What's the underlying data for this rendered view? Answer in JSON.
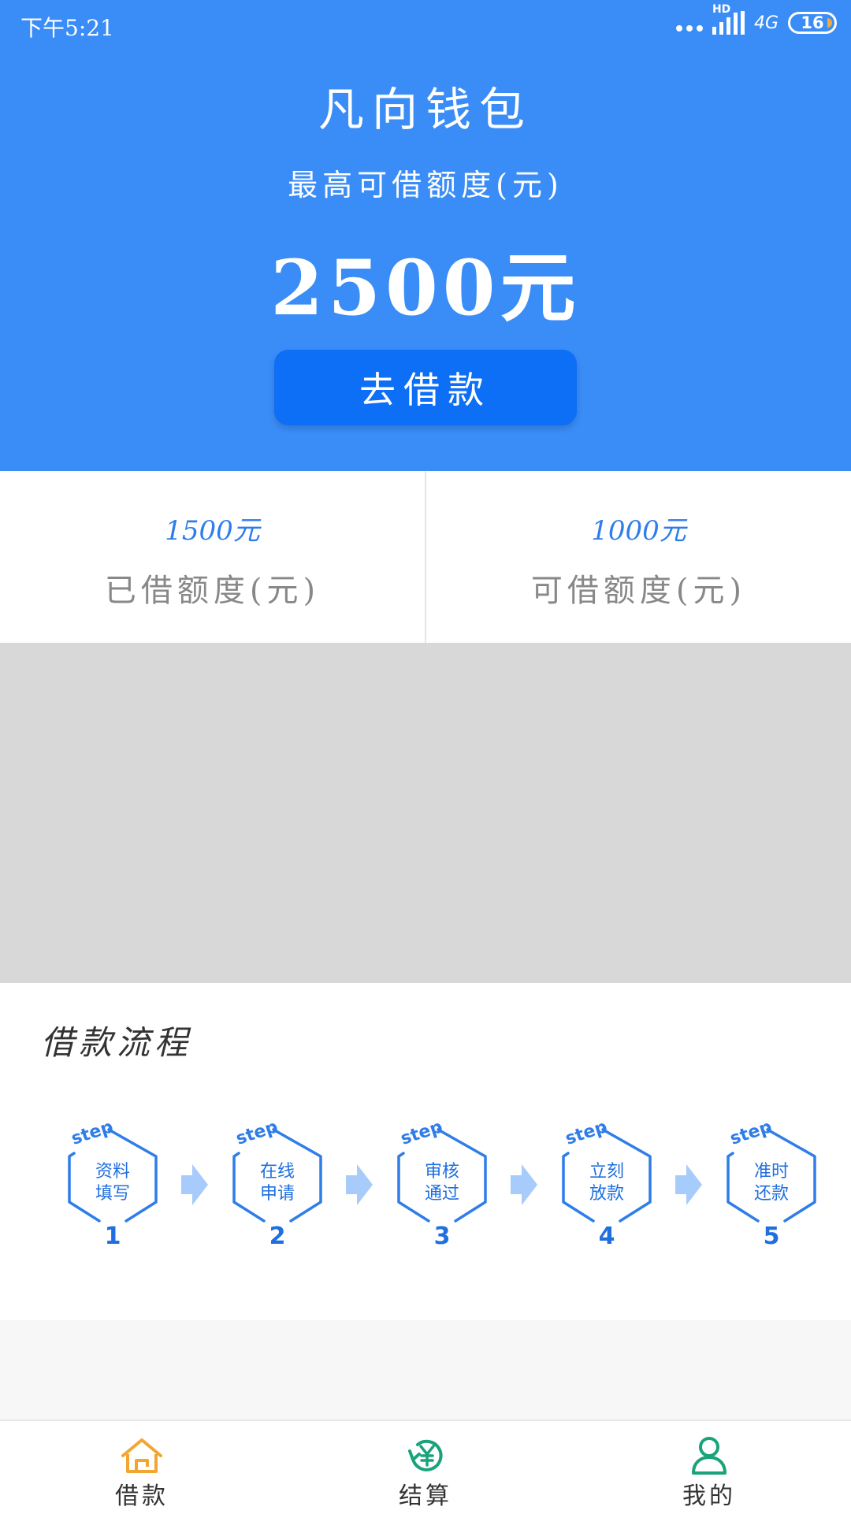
{
  "status_bar": {
    "time": "下午5:21",
    "hd": "HD",
    "network": "4G",
    "battery": "16"
  },
  "header": {
    "app_title": "凡向钱包",
    "limit_label": "最高可借额度(元)",
    "limit_amount": "2500元",
    "borrow_button": "去借款"
  },
  "amounts": {
    "borrowed_value": "1500元",
    "borrowed_label": "已借额度(元)",
    "available_value": "1000元",
    "available_label": "可借额度(元)"
  },
  "process": {
    "title": "借款流程",
    "step_word": "step",
    "steps": [
      {
        "line1": "资料",
        "line2": "填写",
        "num": "1"
      },
      {
        "line1": "在线",
        "line2": "申请",
        "num": "2"
      },
      {
        "line1": "审核",
        "line2": "通过",
        "num": "3"
      },
      {
        "line1": "立刻",
        "line2": "放款",
        "num": "4"
      },
      {
        "line1": "准时",
        "line2": "还款",
        "num": "5"
      }
    ]
  },
  "nav": {
    "items": [
      {
        "label": "借款",
        "icon": "home-icon",
        "active": true
      },
      {
        "label": "结算",
        "icon": "yen-refresh-icon"
      },
      {
        "label": "我的",
        "icon": "person-icon"
      }
    ]
  },
  "colors": {
    "header_bg": "#3a8cf6",
    "button_bg": "#0d6ef6",
    "accent": "#2f7de8",
    "nav_home": "#f3a532",
    "nav_green": "#1aa37a"
  }
}
